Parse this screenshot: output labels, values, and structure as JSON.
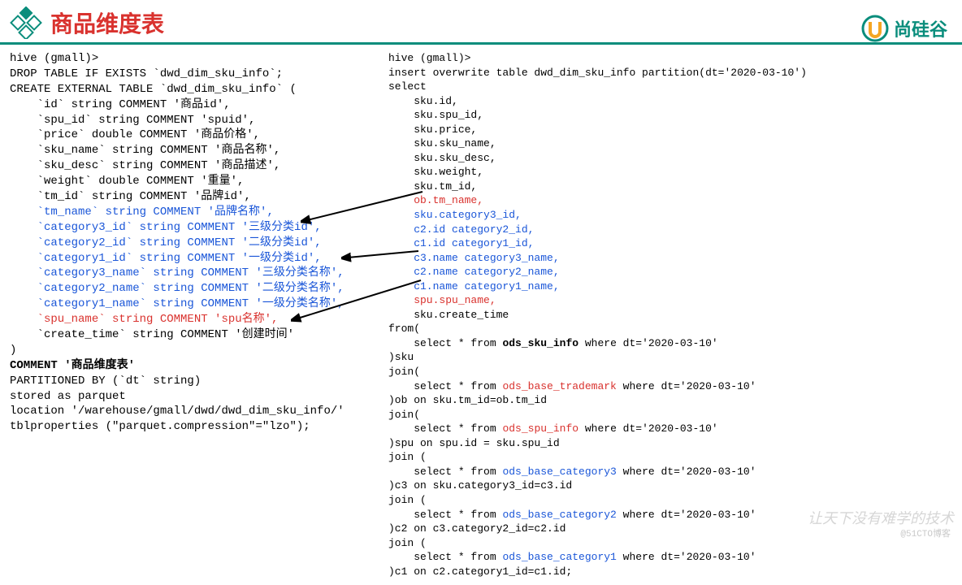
{
  "header": {
    "title": "商品维度表",
    "brand": "尚硅谷"
  },
  "left": {
    "l01": "hive (gmall)>",
    "l02": "DROP TABLE IF EXISTS `dwd_dim_sku_info`;",
    "l03": "CREATE EXTERNAL TABLE `dwd_dim_sku_info` (",
    "l04": "    `id` string COMMENT '商品id',",
    "l05": "    `spu_id` string COMMENT 'spuid',",
    "l06": "    `price` double COMMENT '商品价格',",
    "l07": "    `sku_name` string COMMENT '商品名称',",
    "l08": "    `sku_desc` string COMMENT '商品描述',",
    "l09": "    `weight` double COMMENT '重量',",
    "l10": "    `tm_id` string COMMENT '品牌id',",
    "l11": "    `tm_name` string COMMENT '品牌名称',",
    "l12": "    `category3_id` string COMMENT '三级分类id',",
    "l13": "    `category2_id` string COMMENT '二级分类id',",
    "l14": "    `category1_id` string COMMENT '一级分类id',",
    "l15": "    `category3_name` string COMMENT '三级分类名称',",
    "l16": "    `category2_name` string COMMENT '二级分类名称',",
    "l17": "    `category1_name` string COMMENT '一级分类名称',",
    "l18": "    `spu_name` string COMMENT 'spu名称',",
    "l19": "    `create_time` string COMMENT '创建时间'",
    "l20": ")",
    "l21": "COMMENT '商品维度表'",
    "l22": "PARTITIONED BY (`dt` string)",
    "l23": "stored as parquet",
    "l24": "location '/warehouse/gmall/dwd/dwd_dim_sku_info/'",
    "l25": "tblproperties (\"parquet.compression\"=\"lzo\");"
  },
  "right": {
    "r01": "hive (gmall)>",
    "r02": "insert overwrite table dwd_dim_sku_info partition(dt='2020-03-10')",
    "r03": "select",
    "r04": "    sku.id,",
    "r05": "    sku.spu_id,",
    "r06": "    sku.price,",
    "r07": "    sku.sku_name,",
    "r08": "    sku.sku_desc,",
    "r09": "    sku.weight,",
    "r10": "    sku.tm_id,",
    "r11": "    ob.tm_name,",
    "r12": "    sku.category3_id,",
    "r13": "    c2.id category2_id,",
    "r14": "    c1.id category1_id,",
    "r15": "    c3.name category3_name,",
    "r16": "    c2.name category2_name,",
    "r17": "    c1.name category1_name,",
    "r18": "    spu.spu_name,",
    "r19": "    sku.create_time",
    "r20": "from(",
    "r21a": "    select * from ",
    "r21b": "ods_sku_info",
    "r21c": " where dt='2020-03-10'",
    "r22": ")sku",
    "r23": "join(",
    "r24a": "    select * from ",
    "r24b": "ods_base_trademark",
    "r24c": " where dt='2020-03-10'",
    "r25": ")ob on sku.tm_id=ob.tm_id",
    "r26": "join(",
    "r27a": "    select * from ",
    "r27b": "ods_spu_info",
    "r27c": " where dt='2020-03-10'",
    "r28": ")spu on spu.id = sku.spu_id",
    "r29": "join (",
    "r30a": "    select * from ",
    "r30b": "ods_base_category3",
    "r30c": " where dt='2020-03-10'",
    "r31": ")c3 on sku.category3_id=c3.id",
    "r32": "join (",
    "r33a": "    select * from ",
    "r33b": "ods_base_category2",
    "r33c": " where dt='2020-03-10'",
    "r34": ")c2 on c3.category2_id=c2.id",
    "r35": "join (",
    "r36a": "    select * from ",
    "r36b": "ods_base_category1",
    "r36c": " where dt='2020-03-10'",
    "r37": ")c1 on c2.category1_id=c1.id;"
  },
  "watermark": {
    "slogan": "让天下没有难学的技术",
    "credit": "@51CTO博客"
  }
}
